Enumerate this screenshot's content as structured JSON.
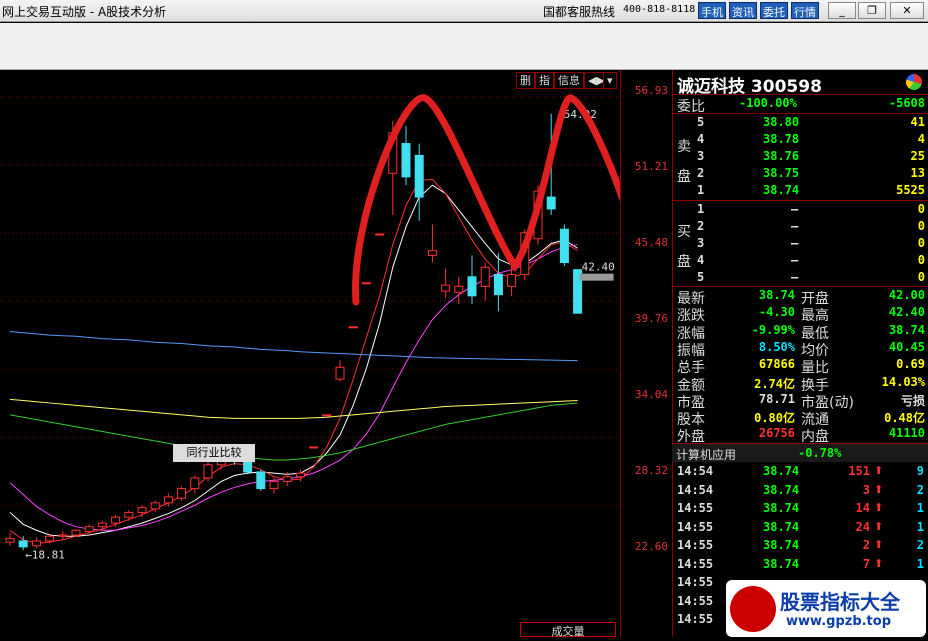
{
  "window": {
    "title": "网上交易互动版 - A股技术分析",
    "hotline_label": "国都客服热线",
    "hotline_number": "400-818-8118",
    "buttons": [
      "手机",
      "资讯",
      "委托",
      "行情"
    ]
  },
  "chart_controls": [
    "删",
    "指",
    "信息",
    "◀▶",
    "▾"
  ],
  "chart_data": {
    "type": "candlestick",
    "y_ticks": [
      "56.93",
      "51.21",
      "45.48",
      "39.76",
      "34.04",
      "28.32",
      "22.60"
    ],
    "ylim": [
      18.0,
      57.5
    ],
    "annotations": {
      "high_label": "54.92",
      "low_label": "18.81",
      "last_label": "42.40"
    },
    "candles": [
      {
        "o": 19.5,
        "h": 20.3,
        "l": 19.2,
        "c": 19.8
      },
      {
        "o": 19.6,
        "h": 20.0,
        "l": 18.81,
        "c": 19.1
      },
      {
        "o": 19.2,
        "h": 19.9,
        "l": 19.0,
        "c": 19.6
      },
      {
        "o": 19.6,
        "h": 20.2,
        "l": 19.4,
        "c": 20.0
      },
      {
        "o": 20.0,
        "h": 20.4,
        "l": 19.7,
        "c": 20.1
      },
      {
        "o": 20.1,
        "h": 20.6,
        "l": 19.9,
        "c": 20.5
      },
      {
        "o": 20.4,
        "h": 21.0,
        "l": 20.2,
        "c": 20.8
      },
      {
        "o": 20.8,
        "h": 21.3,
        "l": 20.5,
        "c": 21.1
      },
      {
        "o": 21.1,
        "h": 21.8,
        "l": 20.8,
        "c": 21.6
      },
      {
        "o": 21.6,
        "h": 22.2,
        "l": 21.3,
        "c": 22.0
      },
      {
        "o": 22.0,
        "h": 22.6,
        "l": 21.6,
        "c": 22.4
      },
      {
        "o": 22.3,
        "h": 23.0,
        "l": 22.0,
        "c": 22.8
      },
      {
        "o": 22.8,
        "h": 23.6,
        "l": 22.5,
        "c": 23.3
      },
      {
        "o": 23.2,
        "h": 24.2,
        "l": 23.0,
        "c": 24.0
      },
      {
        "o": 24.0,
        "h": 25.1,
        "l": 23.6,
        "c": 24.9
      },
      {
        "o": 24.9,
        "h": 26.3,
        "l": 24.6,
        "c": 26.0
      },
      {
        "o": 26.0,
        "h": 27.0,
        "l": 25.6,
        "c": 26.8
      },
      {
        "o": 26.7,
        "h": 26.9,
        "l": 26.0,
        "c": 26.3
      },
      {
        "o": 26.3,
        "h": 26.6,
        "l": 25.2,
        "c": 25.4
      },
      {
        "o": 25.4,
        "h": 25.6,
        "l": 23.8,
        "c": 24.0
      },
      {
        "o": 24.0,
        "h": 24.9,
        "l": 23.6,
        "c": 24.6
      },
      {
        "o": 24.6,
        "h": 25.4,
        "l": 24.2,
        "c": 25.0
      },
      {
        "o": 25.0,
        "h": 25.6,
        "l": 24.6,
        "c": 25.3
      },
      {
        "o": 27.5,
        "h": 27.5,
        "l": 27.5,
        "c": 27.5
      },
      {
        "o": 30.2,
        "h": 30.2,
        "l": 30.2,
        "c": 30.2
      },
      {
        "o": 33.2,
        "h": 34.8,
        "l": 33.0,
        "c": 34.2
      },
      {
        "o": 37.6,
        "h": 37.6,
        "l": 37.6,
        "c": 37.6
      },
      {
        "o": 41.3,
        "h": 41.3,
        "l": 41.3,
        "c": 41.3
      },
      {
        "o": 45.4,
        "h": 45.4,
        "l": 45.4,
        "c": 45.4
      },
      {
        "o": 50.5,
        "h": 54.92,
        "l": 47.0,
        "c": 53.9
      },
      {
        "o": 53.0,
        "h": 54.5,
        "l": 49.5,
        "c": 50.2
      },
      {
        "o": 52.0,
        "h": 53.0,
        "l": 46.5,
        "c": 48.5
      },
      {
        "o": 43.6,
        "h": 46.2,
        "l": 43.0,
        "c": 44.0
      },
      {
        "o": 40.6,
        "h": 42.5,
        "l": 40.0,
        "c": 41.1
      },
      {
        "o": 40.5,
        "h": 41.8,
        "l": 39.5,
        "c": 41.0
      },
      {
        "o": 41.8,
        "h": 43.6,
        "l": 39.5,
        "c": 40.2
      },
      {
        "o": 41.0,
        "h": 43.0,
        "l": 39.8,
        "c": 42.6
      },
      {
        "o": 42.0,
        "h": 43.8,
        "l": 38.9,
        "c": 40.3
      },
      {
        "o": 41.0,
        "h": 43.0,
        "l": 40.2,
        "c": 42.0
      },
      {
        "o": 42.0,
        "h": 45.8,
        "l": 41.5,
        "c": 45.5
      },
      {
        "o": 45.0,
        "h": 49.5,
        "l": 44.5,
        "c": 49.0
      },
      {
        "o": 48.5,
        "h": 55.5,
        "l": 47.0,
        "c": 47.5
      },
      {
        "o": 45.8,
        "h": 46.2,
        "l": 42.7,
        "c": 43.0
      },
      {
        "o": 42.4,
        "h": 42.4,
        "l": 38.7,
        "c": 38.74
      }
    ],
    "moving_averages": [
      {
        "color": "#ffffff",
        "values": [
          22.0,
          21.0,
          20.5,
          20.1,
          20.0,
          20.0,
          20.1,
          20.3,
          20.5,
          20.8,
          21.1,
          21.5,
          21.9,
          22.4,
          23.0,
          23.8,
          24.6,
          25.1,
          25.3,
          25.4,
          25.3,
          25.2,
          25.3,
          25.9,
          27.0,
          28.5,
          31.0,
          34.1,
          37.9,
          42.6,
          46.0,
          48.5,
          49.5,
          48.8,
          47.4,
          46.0,
          44.6,
          43.3,
          42.8,
          42.9,
          43.7,
          44.6,
          44.9,
          44.2
        ]
      },
      {
        "color": "#ff44ff",
        "values": [
          24.5,
          23.5,
          22.5,
          21.8,
          21.2,
          20.8,
          20.6,
          20.5,
          20.5,
          20.7,
          20.9,
          21.2,
          21.6,
          22.1,
          22.6,
          23.2,
          23.7,
          24.1,
          24.4,
          24.6,
          24.7,
          24.8,
          25.0,
          25.3,
          25.8,
          26.4,
          27.3,
          28.6,
          30.3,
          32.5,
          34.6,
          36.5,
          38.2,
          39.4,
          40.3,
          41.0,
          41.6,
          42.1,
          42.4,
          42.8,
          43.3,
          43.9,
          44.3,
          44.5
        ]
      },
      {
        "color": "#ff3030",
        "values": [
          20.5,
          19.7,
          19.4,
          19.5,
          19.7,
          20.0,
          20.3,
          20.6,
          21.0,
          21.4,
          21.8,
          22.3,
          22.8,
          23.4,
          24.1,
          25.0,
          25.8,
          26.1,
          26.0,
          25.6,
          25.0,
          24.7,
          24.8,
          25.8,
          27.5,
          29.9,
          33.2,
          36.7,
          40.2,
          44.5,
          47.8,
          49.9,
          50.0,
          48.8,
          46.8,
          44.9,
          43.3,
          42.1,
          41.7,
          42.1,
          43.3,
          44.5,
          44.7,
          44.0
        ]
      },
      {
        "color": "#ffff66",
        "values": [
          31.5,
          31.4,
          31.3,
          31.2,
          31.1,
          31.0,
          30.9,
          30.8,
          30.7,
          30.6,
          30.5,
          30.4,
          30.3,
          30.2,
          30.1,
          30.0,
          29.95,
          29.9,
          29.9,
          29.9,
          29.9,
          29.9,
          29.9,
          29.95,
          30.0,
          30.1,
          30.2,
          30.3,
          30.4,
          30.5,
          30.6,
          30.7,
          30.8,
          30.9,
          30.95,
          31.0,
          31.05,
          31.1,
          31.15,
          31.2,
          31.25,
          31.3,
          31.35,
          31.4
        ]
      },
      {
        "color": "#33cc33",
        "values": [
          30.2,
          30.0,
          29.8,
          29.6,
          29.4,
          29.2,
          29.0,
          28.8,
          28.6,
          28.4,
          28.2,
          28.0,
          27.8,
          27.6,
          27.4,
          27.2,
          27.0,
          26.8,
          26.6,
          26.5,
          26.4,
          26.4,
          26.5,
          26.6,
          26.8,
          27.0,
          27.3,
          27.6,
          27.9,
          28.2,
          28.5,
          28.8,
          29.1,
          29.4,
          29.6,
          29.8,
          30.0,
          30.2,
          30.4,
          30.6,
          30.8,
          31.0,
          31.1,
          31.2
        ]
      },
      {
        "color": "#5599ff",
        "values": [
          37.2,
          37.1,
          37.0,
          36.9,
          36.85,
          36.8,
          36.7,
          36.6,
          36.55,
          36.5,
          36.4,
          36.3,
          36.25,
          36.2,
          36.1,
          36.0,
          35.95,
          35.9,
          35.8,
          35.7,
          35.65,
          35.6,
          35.5,
          35.45,
          35.4,
          35.35,
          35.3,
          35.25,
          35.2,
          35.15,
          35.1,
          35.05,
          35.0,
          34.98,
          34.95,
          34.92,
          34.9,
          34.88,
          34.86,
          34.84,
          34.82,
          34.8,
          34.78,
          34.76
        ]
      }
    ]
  },
  "volume_label": "成交量",
  "quote": {
    "name": "诚迈科技",
    "code": "300598",
    "weibi": {
      "label": "委比",
      "pct": "-100.00%",
      "diff": "-5608"
    },
    "sell_label": "卖盘",
    "buy_label": "买盘",
    "asks": [
      {
        "lvl": "5",
        "price": "38.80",
        "vol": "41"
      },
      {
        "lvl": "4",
        "price": "38.78",
        "vol": "4"
      },
      {
        "lvl": "3",
        "price": "38.76",
        "vol": "25"
      },
      {
        "lvl": "2",
        "price": "38.75",
        "vol": "13"
      },
      {
        "lvl": "1",
        "price": "38.74",
        "vol": "5525"
      }
    ],
    "bids": [
      {
        "lvl": "1",
        "price": "—",
        "vol": "0"
      },
      {
        "lvl": "2",
        "price": "—",
        "vol": "0"
      },
      {
        "lvl": "3",
        "price": "—",
        "vol": "0"
      },
      {
        "lvl": "4",
        "price": "—",
        "vol": "0"
      },
      {
        "lvl": "5",
        "price": "—",
        "vol": "0"
      }
    ],
    "stats": [
      {
        "l1": "最新",
        "v1": "38.74",
        "c1": "g",
        "l2": "开盘",
        "v2": "42.00",
        "c2": "g"
      },
      {
        "l1": "涨跌",
        "v1": "-4.30",
        "c1": "g",
        "l2": "最高",
        "v2": "42.40",
        "c2": "g"
      },
      {
        "l1": "涨幅",
        "v1": "-9.99%",
        "c1": "g",
        "l2": "最低",
        "v2": "38.74",
        "c2": "g"
      },
      {
        "l1": "振幅",
        "v1": "8.50%",
        "c1": "c",
        "l2": "均价",
        "v2": "40.45",
        "c2": "g"
      },
      {
        "l1": "总手",
        "v1": "67866",
        "c1": "y",
        "l2": "量比",
        "v2": "0.69",
        "c2": "y"
      },
      {
        "l1": "金额",
        "v1": "2.74亿",
        "c1": "y",
        "l2": "换手",
        "v2": "14.03%",
        "c2": "y"
      },
      {
        "l1": "市盈",
        "v1": "78.71",
        "c1": "w",
        "l2": "市盈(动)",
        "v2": "亏损",
        "c2": "w"
      },
      {
        "l1": "股本",
        "v1": "0.80亿",
        "c1": "y",
        "l2": "流通",
        "v2": "0.48亿",
        "c2": "y"
      },
      {
        "l1": "外盘",
        "v1": "26756",
        "c1": "r",
        "l2": "内盘",
        "v2": "41110",
        "c2": "g"
      }
    ],
    "sector": {
      "name": "计算机应用",
      "change": "-0.78%",
      "button": "同行业比较"
    },
    "ticks": [
      {
        "time": "14:54",
        "price": "38.74",
        "vol": "151",
        "n": "9"
      },
      {
        "time": "14:54",
        "price": "38.74",
        "vol": "3",
        "n": "2"
      },
      {
        "time": "14:55",
        "price": "38.74",
        "vol": "14",
        "n": "1"
      },
      {
        "time": "14:55",
        "price": "38.74",
        "vol": "24",
        "n": "1"
      },
      {
        "time": "14:55",
        "price": "38.74",
        "vol": "2",
        "n": "2"
      },
      {
        "time": "14:55",
        "price": "38.74",
        "vol": "7",
        "n": "1"
      },
      {
        "time": "14:55",
        "price": "",
        "vol": "",
        "n": ""
      },
      {
        "time": "14:55",
        "price": "",
        "vol": "",
        "n": ""
      },
      {
        "time": "14:55",
        "price": "",
        "vol": "",
        "n": ""
      }
    ]
  },
  "watermark": {
    "title": "股票指标大全",
    "url": "www.gpzb.top"
  }
}
